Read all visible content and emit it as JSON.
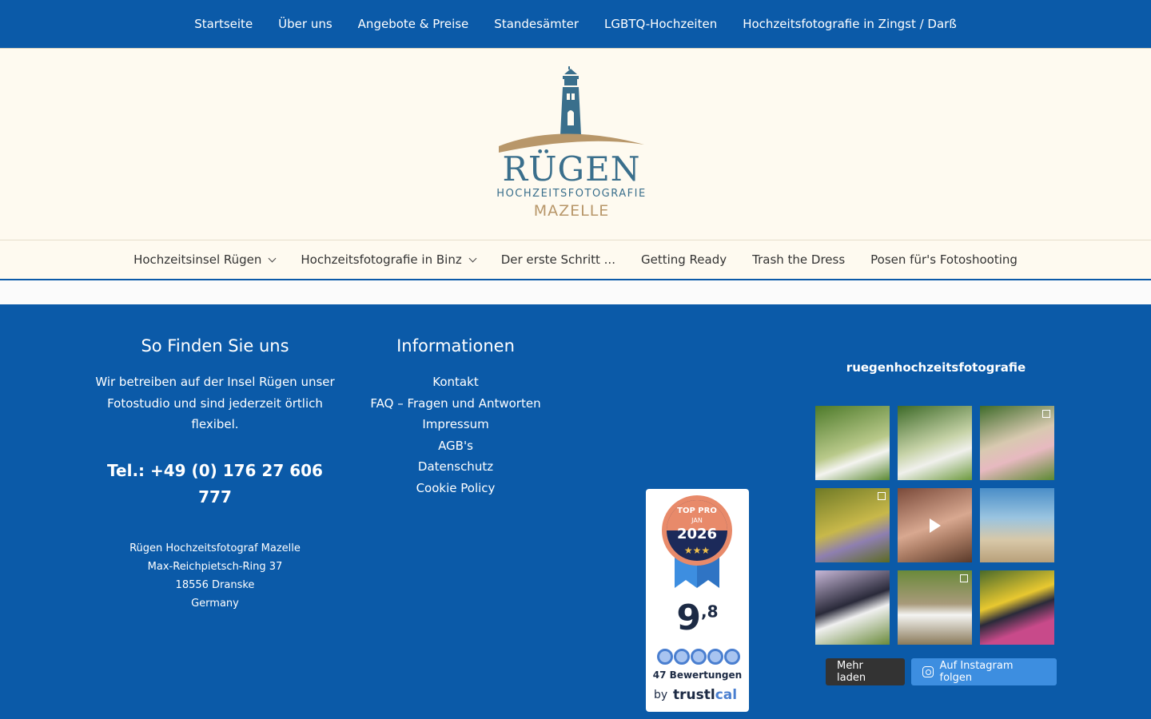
{
  "top_menu": [
    "Startseite",
    "Über uns",
    "Angebote & Preise",
    "Standesämter",
    "LGBTQ-Hochzeiten",
    "Hochzeitsfotografie in Zingst / Darß"
  ],
  "logo": {
    "brand": "RÜGEN",
    "line1": "HOCHZEITSFOTOGRAFIE",
    "line2": "MAZELLE"
  },
  "sub_menu": [
    {
      "label": "Hochzeitsinsel Rügen",
      "dropdown": true
    },
    {
      "label": "Hochzeitsfotografie in Binz",
      "dropdown": true
    },
    {
      "label": "Der erste Schritt ...",
      "dropdown": false
    },
    {
      "label": "Getting Ready",
      "dropdown": false
    },
    {
      "label": "Trash the Dress",
      "dropdown": false
    },
    {
      "label": "Posen für's Fotoshooting",
      "dropdown": false
    }
  ],
  "find_us": {
    "title": "So Finden Sie uns",
    "intro": "Wir betreiben auf der Insel Rügen unser Fotostudio und sind jederzeit örtlich flexibel.",
    "phone": "Tel.: +49 (0) 176 27 606 777",
    "address": [
      "Rügen Hochzeitsfotograf Mazelle",
      "Max-Reichpietsch-Ring 37",
      "18556 Dranske",
      "Germany"
    ]
  },
  "info": {
    "title": "Informationen",
    "links": [
      "Kontakt",
      "FAQ – Fragen und Antworten",
      "Impressum",
      "AGB's",
      "Datenschutz",
      "Cookie Policy"
    ]
  },
  "badge": {
    "top": "TOP PRO",
    "month": "JAN",
    "year": "2026",
    "score_main": "9",
    "score_dec": ",8",
    "reviews": "47 Bewertungen",
    "by": "by",
    "brand_a": "trustl",
    "brand_b": "cal"
  },
  "instagram": {
    "handle": "ruegenhochzeitsfotografie",
    "tiles": [
      {
        "name": "ig-post-1",
        "bg": "linear-gradient(160deg,#4d7a2a,#b9c98a 55%,#f4f4f0 70%,#5c8a33)",
        "overlay": ""
      },
      {
        "name": "ig-post-2",
        "bg": "linear-gradient(160deg,#3d6a28,#c7d3a8 50%,#f0f0ec 68%,#6d9a3e)",
        "overlay": ""
      },
      {
        "name": "ig-post-3",
        "bg": "linear-gradient(160deg,#3f6b2a,#d8c9b0 45%,#e7b9c0 65%,#5c8a33)",
        "overlay": "gallery"
      },
      {
        "name": "ig-post-4",
        "bg": "linear-gradient(160deg,#6f7a26,#c8b84a 50%,#8e7fb0 70%,#5c6a22)",
        "overlay": "gallery"
      },
      {
        "name": "ig-post-5",
        "bg": "linear-gradient(160deg,#7a4a3a,#d8a890 50%,#a87a62 70%,#5a3a2a)",
        "overlay": "play"
      },
      {
        "name": "ig-post-6",
        "bg": "linear-gradient(180deg,#4a8ec8,#9ac4e0 40%,#d8c8a8 70%,#b8a07a)",
        "overlay": ""
      },
      {
        "name": "ig-post-7",
        "bg": "linear-gradient(160deg,#c8b8d8,#2a2a3a 45%,#f0f0f0 60%,#6a8a3a)",
        "overlay": ""
      },
      {
        "name": "ig-post-8",
        "bg": "linear-gradient(180deg,#6a8a3a,#a89a7a 45%,#f4f4f2 60%,#8a7a5a)",
        "overlay": "gallery"
      },
      {
        "name": "ig-post-9",
        "bg": "linear-gradient(160deg,#4a6a2a,#e8c830 40%,#2a2a3a 55%,#c84a8a 75%)",
        "overlay": ""
      }
    ],
    "load_more": "Mehr laden",
    "follow": "Auf Instagram folgen"
  }
}
